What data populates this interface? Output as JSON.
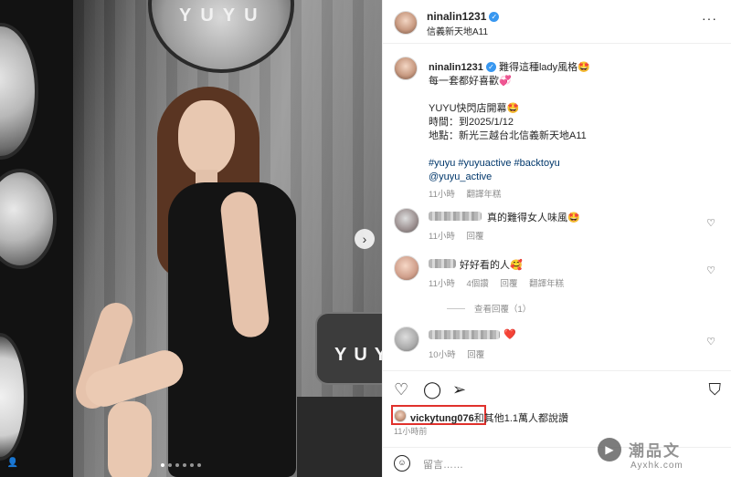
{
  "photo": {
    "signage_top": "YUYU",
    "signage_box": "YUYU"
  },
  "header": {
    "username": "ninalin1231",
    "location": "信義新天地A11",
    "more": "···"
  },
  "caption": {
    "username": "ninalin1231",
    "first_line": "難得這種lady風格🤩",
    "line2": "每一套都好喜歡💞",
    "event_title": "YUYU快閃店開幕🤩",
    "event_time": "時間：到2025/1/12",
    "event_place": "地點：新光三越台北信義新天地A11",
    "hashtags": "#yuyu #yuyuactive #backtoyu",
    "mention": "@yuyu_active",
    "time": "11小時",
    "translate": "翻譯年糕"
  },
  "comments": [
    {
      "text": "真的難得女人味風🤩",
      "time": "11小時",
      "reply": "回覆",
      "extra": ""
    },
    {
      "text": "好好看的人🥰",
      "time": "11小時",
      "likes": "4個讚",
      "reply": "回覆",
      "extra": "翻譯年糕"
    },
    {
      "text": "❤️",
      "time": "10小時",
      "reply": "回覆",
      "extra": ""
    }
  ],
  "view_replies": "查看回覆（1）",
  "likes": {
    "user": "vickytung076",
    "rest": "和其他1.1萬人都說讚"
  },
  "time_ago": "11小時前",
  "add_comment": {
    "placeholder": "留言……"
  },
  "watermark": {
    "text": "潮品文",
    "url": "Ayxhk.com"
  },
  "icons": [
    "heart-icon",
    "comment-icon",
    "share-icon",
    "bookmark-icon",
    "emoji-icon",
    "more-icon",
    "verified-icon"
  ]
}
